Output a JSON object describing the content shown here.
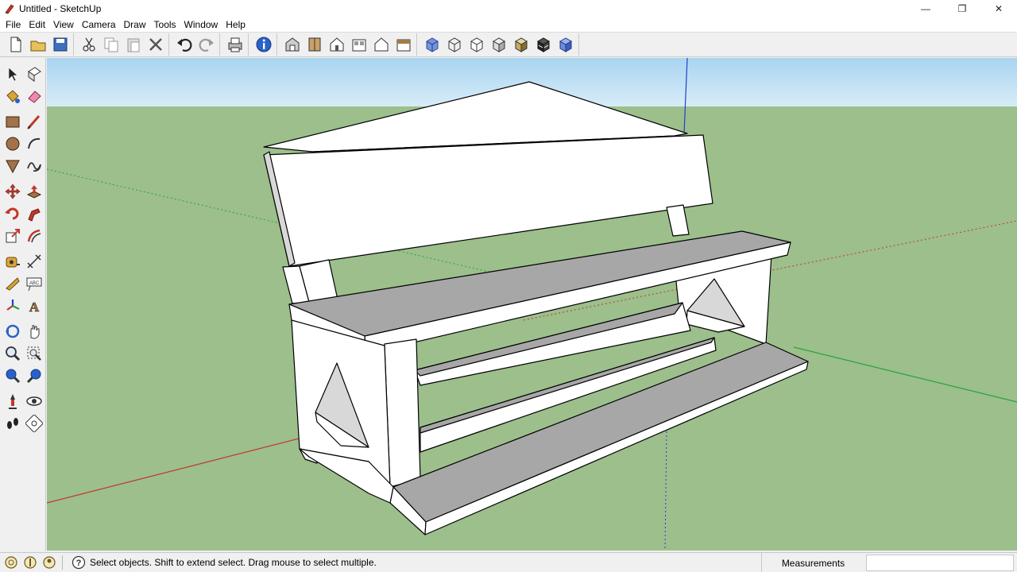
{
  "window": {
    "title": "Untitled - SketchUp",
    "minimize_glyph": "—",
    "restore_glyph": "❐",
    "close_glyph": "✕"
  },
  "menu": [
    "File",
    "Edit",
    "View",
    "Camera",
    "Draw",
    "Tools",
    "Window",
    "Help"
  ],
  "toolbar": {
    "groups": [
      [
        "new-icon",
        "open-icon",
        "save-icon"
      ],
      [
        "cut-icon",
        "copy-icon",
        "paste-icon",
        "erase-selection-icon"
      ],
      [
        "undo-icon",
        "redo-icon"
      ],
      [
        "print-icon"
      ],
      [
        "model-info-icon"
      ],
      [
        "iso-view-icon",
        "top-view-icon",
        "front-view-icon",
        "right-view-icon",
        "back-view-icon",
        "left-view-icon"
      ],
      [
        "xray-icon",
        "wireframe-icon",
        "hidden-line-icon",
        "shaded-icon",
        "shaded-textures-icon",
        "monochrome-icon",
        "back-edges-icon"
      ]
    ]
  },
  "palette": [
    [
      "select-icon",
      "make-component-icon"
    ],
    [
      "paint-bucket-icon",
      "eraser-icon"
    ],
    [
      "rectangle-icon",
      "line-icon"
    ],
    [
      "circle-icon",
      "arc-icon"
    ],
    [
      "polygon-icon",
      "freehand-icon"
    ],
    [
      "move-icon",
      "push-pull-icon"
    ],
    [
      "rotate-icon",
      "follow-me-icon"
    ],
    [
      "scale-icon",
      "offset-icon"
    ],
    [
      "tape-measure-icon",
      "dimension-icon"
    ],
    [
      "protractor-icon",
      "text-icon"
    ],
    [
      "axes-icon",
      "3d-text-icon"
    ],
    [
      "orbit-icon",
      "pan-icon"
    ],
    [
      "zoom-icon",
      "zoom-window-icon"
    ],
    [
      "zoom-extents-icon",
      "previous-view-icon"
    ],
    [
      "position-camera-icon",
      "look-around-icon"
    ],
    [
      "walk-icon",
      "section-plane-icon"
    ]
  ],
  "status": {
    "icons": [
      "geo-location-icon",
      "credits-icon",
      "user-icon"
    ],
    "help_icon": "help-icon",
    "help_glyph": "?",
    "message": "Select objects. Shift to extend select. Drag mouse to select multiple.",
    "measurements_label": "Measurements",
    "measurements_value": ""
  },
  "colors": {
    "sky_top": "#a9d4f0",
    "sky_bottom": "#d7ecf8",
    "ground": "#9cbf8c",
    "face_light": "#ffffff",
    "face_grey": "#a7a7a7",
    "face_mid": "#d8d8d8",
    "axis_red": "#c0392b",
    "axis_green": "#27a33b",
    "axis_blue": "#2040d0"
  }
}
